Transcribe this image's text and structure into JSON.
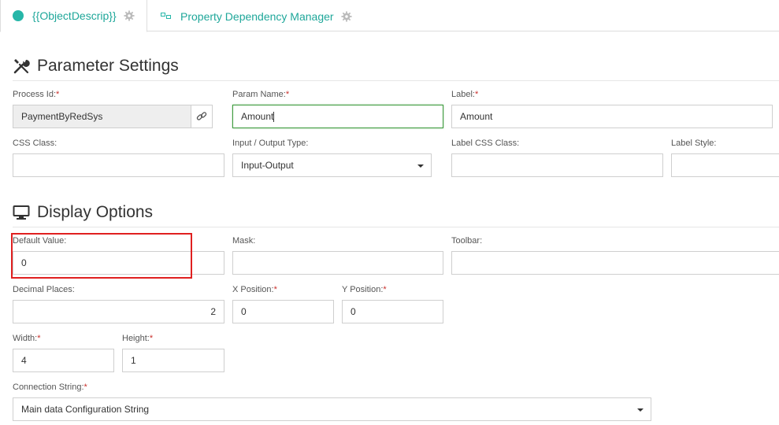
{
  "tabs": [
    {
      "label": "{{ObjectDescrip}}",
      "active": true
    },
    {
      "label": "Property Dependency Manager",
      "active": false
    }
  ],
  "colors": {
    "accent": "#26b6a8",
    "required": "#c9302c",
    "focus": "#3c9a3c",
    "highlight": "#e02020"
  },
  "parameter_settings": {
    "title": "Parameter Settings",
    "icon": "tools-icon",
    "process_id": {
      "label": "Process Id:",
      "required": "*",
      "value": "PaymentByRedSys"
    },
    "param_name": {
      "label": "Param Name:",
      "required": "*",
      "value": "Amount"
    },
    "label_field": {
      "label": "Label:",
      "required": "*",
      "value": "Amount"
    },
    "css_class": {
      "label": "CSS Class:",
      "value": ""
    },
    "io_type": {
      "label": "Input / Output Type:",
      "value": "Input-Output"
    },
    "label_css_class": {
      "label": "Label CSS Class:",
      "value": ""
    },
    "label_style": {
      "label": "Label Style:",
      "value": ""
    }
  },
  "display_options": {
    "title": "Display Options",
    "icon": "monitor-icon",
    "default_value": {
      "label": "Default Value:",
      "value": "0"
    },
    "mask": {
      "label": "Mask:",
      "value": ""
    },
    "toolbar": {
      "label": "Toolbar:",
      "value": ""
    },
    "decimal_places": {
      "label": "Decimal Places:",
      "value": "2"
    },
    "x_position": {
      "label": "X Position:",
      "required": "*",
      "value": "0"
    },
    "y_position": {
      "label": "Y Position:",
      "required": "*",
      "value": "0"
    },
    "width": {
      "label": "Width:",
      "required": "*",
      "value": "4"
    },
    "height": {
      "label": "Height:",
      "required": "*",
      "value": "1"
    },
    "connection_string": {
      "label": "Connection String:",
      "required": "*",
      "value": "Main data Configuration String"
    }
  }
}
